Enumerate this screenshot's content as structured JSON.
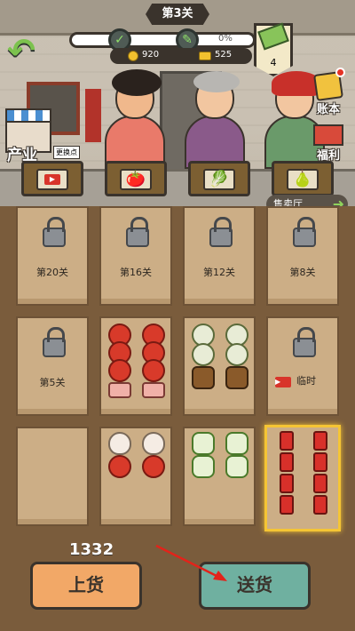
{
  "header": {
    "level_label": "第3关",
    "progress_percent": 0,
    "progress_text": "0%",
    "coins": "920",
    "gold": "525",
    "stars_count": "4"
  },
  "side": {
    "industry_label": "产业",
    "industry_sub": "更换点",
    "ledger_label": "账本",
    "welfare_label": "福利",
    "sales_hall_label": "售卖厅"
  },
  "baskets": [
    {
      "icon": "video-ad-icon"
    },
    {
      "icon": "tomato-icon",
      "glyph": "🍅"
    },
    {
      "icon": "cabbage-icon",
      "glyph": "🥬"
    },
    {
      "icon": "pear-icon",
      "glyph": "🍐"
    }
  ],
  "slots": {
    "row1": [
      {
        "state": "locked",
        "label": "第20关"
      },
      {
        "state": "locked",
        "label": "第16关"
      },
      {
        "state": "locked",
        "label": "第12关"
      },
      {
        "state": "locked",
        "label": "第8关"
      }
    ],
    "row2": [
      {
        "state": "locked",
        "label": "第5关"
      },
      {
        "state": "filled",
        "items": [
          "tomato",
          "tomato",
          "tomato",
          "tomato",
          "tomato",
          "tomato",
          "meat",
          "meat"
        ]
      },
      {
        "state": "filled",
        "items": [
          "cauliflower",
          "cauliflower",
          "cauliflower",
          "cauliflower",
          "yam",
          "yam"
        ]
      },
      {
        "state": "temporary",
        "label": "临时"
      }
    ],
    "row3": [
      {
        "state": "empty"
      },
      {
        "state": "filled",
        "items": [
          "egg",
          "egg",
          "tomato",
          "tomato"
        ]
      },
      {
        "state": "filled",
        "items": [
          "cabbage",
          "cabbage",
          "cabbage",
          "cabbage"
        ]
      },
      {
        "state": "filled",
        "items": [
          "firecracker",
          "firecracker",
          "firecracker",
          "firecracker",
          "firecracker",
          "firecracker",
          "firecracker",
          "firecracker"
        ]
      }
    ]
  },
  "bottom": {
    "cash": "1332",
    "load_label": "上货",
    "deliver_label": "送货"
  },
  "colors": {
    "accent_orange": "#f2a867",
    "accent_teal": "#6fb0a0",
    "highlight": "#f5c534"
  }
}
